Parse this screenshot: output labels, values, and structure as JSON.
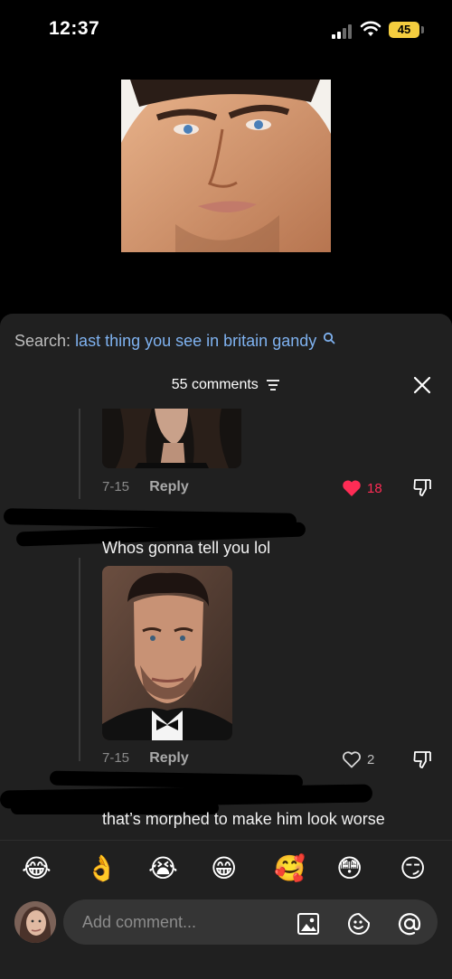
{
  "status": {
    "time": "12:37",
    "battery": "45"
  },
  "search": {
    "prefix": "Search:",
    "query": "last thing you see in britain gandy"
  },
  "comments": {
    "count_label": "55 comments",
    "items": [
      {
        "date": "7-15",
        "reply": "Reply",
        "likes": "18",
        "liked": true
      },
      {
        "text": "Whos gonna tell you lol",
        "date": "7-15",
        "reply": "Reply",
        "likes": "2",
        "liked": false
      },
      {
        "text": "that’s morphed to make him look worse"
      }
    ]
  },
  "emoji_bar": [
    "😂",
    "👌",
    "😭",
    "😁",
    "🥰",
    "😳",
    "😏"
  ],
  "composer": {
    "placeholder": "Add comment..."
  },
  "colors": {
    "like_red": "#fe2c55",
    "search_blue": "#7fb2f0",
    "battery": "#f4cd3f",
    "sheet": "#202020"
  }
}
